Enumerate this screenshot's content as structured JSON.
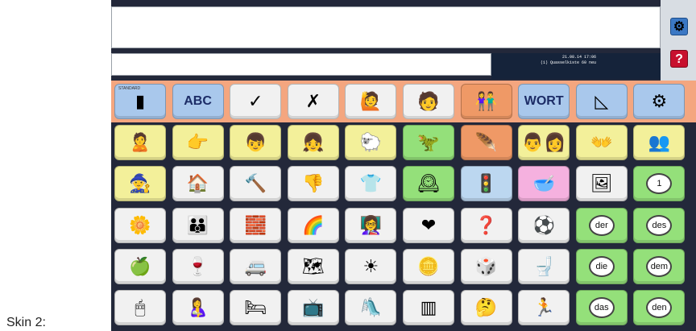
{
  "caption": "Skin 2:",
  "status": {
    "datetime": "21.08.14 17:06",
    "file": "(1) Quasselkiste 60 neu"
  },
  "colors": {
    "blue": "#a9c8ec",
    "white": "#f1f1f1",
    "orange": "#ef9966",
    "yellow": "#f3f09a",
    "green": "#94e07a",
    "pink": "#f5b1df"
  },
  "rows": [
    [
      {
        "name": "standard-button",
        "color": "blue",
        "small": "STANDARD",
        "symbol": "▮"
      },
      {
        "name": "abc-button",
        "color": "blue",
        "label": "ABC"
      },
      {
        "name": "yes-button",
        "color": "white",
        "symbol": "✓"
      },
      {
        "name": "no-button",
        "color": "white",
        "symbol": "✗"
      },
      {
        "name": "person-waving-button",
        "color": "white",
        "symbol": "🙋"
      },
      {
        "name": "person-button",
        "color": "white",
        "symbol": "🧑"
      },
      {
        "name": "two-people-button",
        "color": "orange",
        "symbol": "👫"
      },
      {
        "name": "wort-button",
        "color": "blue",
        "label": "WORT"
      },
      {
        "name": "erase-button",
        "color": "blue",
        "symbol": "◺"
      },
      {
        "name": "settings-button",
        "color": "blue",
        "symbol": "⚙"
      }
    ],
    [
      {
        "name": "i-button",
        "color": "yellow",
        "symbol": "🙎"
      },
      {
        "name": "you-button",
        "color": "yellow",
        "symbol": "👉"
      },
      {
        "name": "he-button",
        "color": "yellow",
        "symbol": "👦"
      },
      {
        "name": "she-button",
        "color": "yellow",
        "symbol": "👧"
      },
      {
        "name": "sheep-button",
        "color": "yellow",
        "symbol": "🐑"
      },
      {
        "name": "dinosaur-button",
        "color": "green",
        "symbol": "🦖"
      },
      {
        "name": "indian-button",
        "color": "orange",
        "symbol": "🪶"
      },
      {
        "name": "we-button",
        "color": "yellow",
        "symbol": "👨‍👩"
      },
      {
        "name": "you-plural-button",
        "color": "yellow",
        "symbol": "👐"
      },
      {
        "name": "they-button",
        "color": "yellow",
        "symbol": "👥"
      }
    ],
    [
      {
        "name": "magician-button",
        "color": "yellow",
        "symbol": "🧙"
      },
      {
        "name": "house-button",
        "color": "white",
        "symbol": "🏠"
      },
      {
        "name": "hammer-button",
        "color": "white",
        "symbol": "🔨"
      },
      {
        "name": "thumb-down-button",
        "color": "white",
        "symbol": "👎"
      },
      {
        "name": "shirt-button",
        "color": "white",
        "symbol": "👕"
      },
      {
        "name": "clock-tower-button",
        "color": "green",
        "symbol": "🕰"
      },
      {
        "name": "traffic-light-button",
        "color": "lblue",
        "symbol": "🚦"
      },
      {
        "name": "bowl-button",
        "color": "pink",
        "symbol": "🥣"
      },
      {
        "name": "frame-button",
        "color": "white",
        "symbol": "🖼"
      },
      {
        "name": "number-one-button",
        "color": "green",
        "chip": "1"
      }
    ],
    [
      {
        "name": "flower-button",
        "color": "white",
        "symbol": "🌼"
      },
      {
        "name": "family-button",
        "color": "white",
        "symbol": "👪"
      },
      {
        "name": "lego-brick-button",
        "color": "white",
        "symbol": "🧱"
      },
      {
        "name": "rainbow-button",
        "color": "white",
        "symbol": "🌈"
      },
      {
        "name": "teacher-button",
        "color": "white",
        "symbol": "👩‍🏫"
      },
      {
        "name": "heart-button",
        "color": "white",
        "symbol": "❤"
      },
      {
        "name": "question-book-button",
        "color": "white",
        "symbol": "❓"
      },
      {
        "name": "soccer-ball-button",
        "color": "white",
        "symbol": "⚽"
      },
      {
        "name": "der-button",
        "color": "green",
        "chip": "der"
      },
      {
        "name": "des-button",
        "color": "green",
        "chip": "des"
      }
    ],
    [
      {
        "name": "apple-button",
        "color": "white",
        "symbol": "🍏"
      },
      {
        "name": "glass-button",
        "color": "white",
        "symbol": "🍷"
      },
      {
        "name": "van-button",
        "color": "white",
        "symbol": "🚐"
      },
      {
        "name": "map-button",
        "color": "white",
        "symbol": "🗺"
      },
      {
        "name": "sun-button",
        "color": "white",
        "symbol": "☀"
      },
      {
        "name": "coin-button",
        "color": "white",
        "symbol": "🪙"
      },
      {
        "name": "dice-button",
        "color": "white",
        "symbol": "🎲"
      },
      {
        "name": "toilet-button",
        "color": "white",
        "symbol": "🚽"
      },
      {
        "name": "die-button",
        "color": "green",
        "chip": "die"
      },
      {
        "name": "dem-button",
        "color": "green",
        "chip": "dem"
      }
    ],
    [
      {
        "name": "mouse-button",
        "color": "white",
        "symbol": "🖱"
      },
      {
        "name": "mother-child-button",
        "color": "white",
        "symbol": "🤱"
      },
      {
        "name": "bed-button",
        "color": "white",
        "symbol": "🛏"
      },
      {
        "name": "tv-button",
        "color": "white",
        "symbol": "📺"
      },
      {
        "name": "slide-button",
        "color": "white",
        "symbol": "🛝"
      },
      {
        "name": "prison-button",
        "color": "white",
        "symbol": "▥"
      },
      {
        "name": "thinking-button",
        "color": "white",
        "symbol": "🤔"
      },
      {
        "name": "child-running-button",
        "color": "white",
        "symbol": "🏃"
      },
      {
        "name": "das-button",
        "color": "green",
        "chip": "das"
      },
      {
        "name": "den-button",
        "color": "green",
        "chip": "den"
      }
    ]
  ]
}
